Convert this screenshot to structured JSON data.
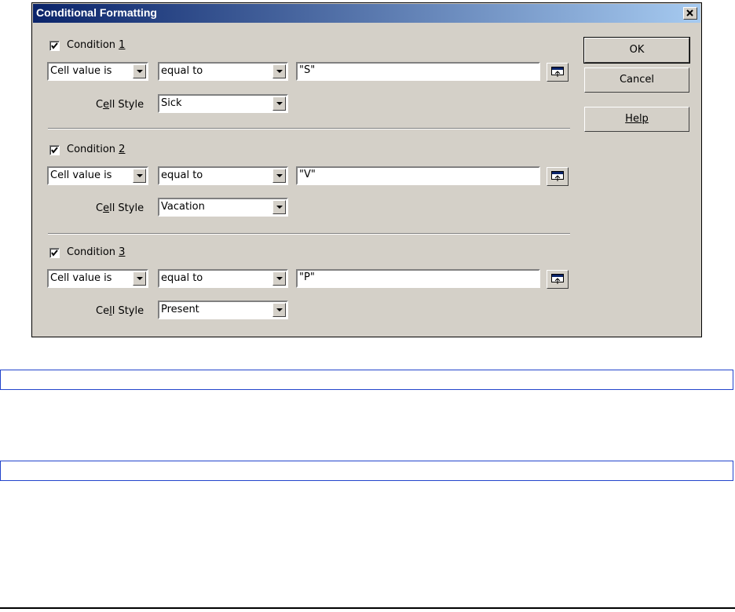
{
  "dialog": {
    "title": "Conditional Formatting",
    "close_icon": "close-x-icon"
  },
  "conditions": [
    {
      "label_prefix": "Condition ",
      "number": "1",
      "checked": true,
      "type": "Cell value is",
      "operator": "equal to",
      "value": "\"S\"",
      "style_label_pre": "C",
      "style_label_ul": "e",
      "style_label_post": "ll Style",
      "style": "Sick"
    },
    {
      "label_prefix": "Condition ",
      "number": "2",
      "checked": true,
      "type": "Cell value is",
      "operator": "equal to",
      "value": "\"V\"",
      "style_label_pre": "C",
      "style_label_ul": "e",
      "style_label_post": "ll Style",
      "style": "Vacation"
    },
    {
      "label_prefix": "Condition ",
      "number": "3",
      "checked": true,
      "type": "Cell value is",
      "operator": "equal to",
      "value": "\"P\"",
      "style_label_pre": "Ce",
      "style_label_ul": "l",
      "style_label_post": "l Style",
      "style": "Present"
    }
  ],
  "buttons": {
    "ok": "OK",
    "cancel": "Cancel",
    "help": "Help"
  },
  "colors": {
    "title_start": "#0a246a",
    "title_end": "#a6caf0",
    "dialog_bg": "#d4d0c8",
    "info_border": "#2244cc"
  }
}
